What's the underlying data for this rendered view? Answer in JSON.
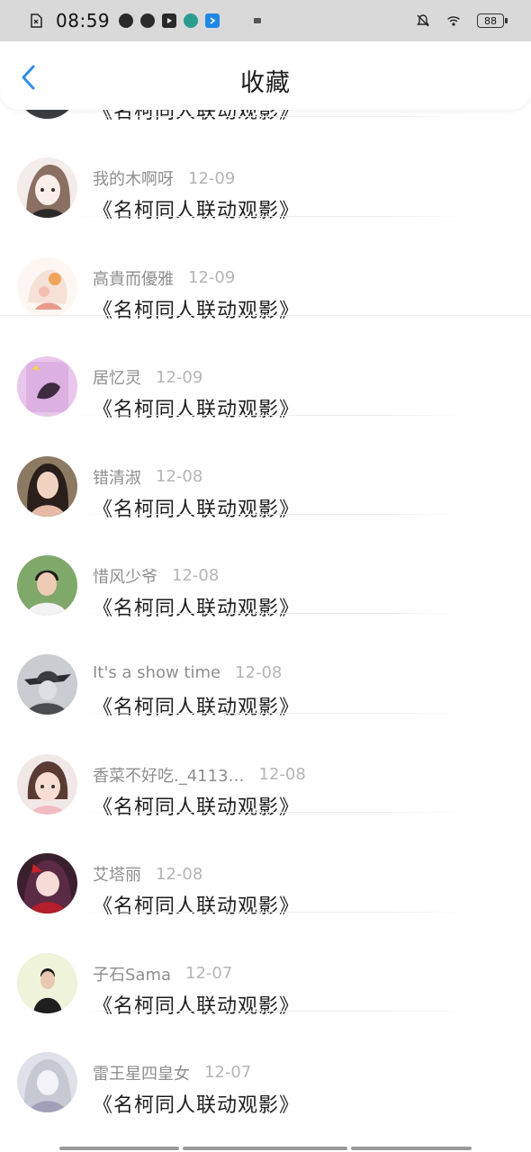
{
  "status_bar": {
    "time": "08:59",
    "battery": "88"
  },
  "header": {
    "title": "收藏"
  },
  "items": [
    {
      "user": "",
      "date": "",
      "title": "《名柯同人联动观影》"
    },
    {
      "user": "我的木啊呀",
      "date": "12-09",
      "title": "《名柯同人联动观影》"
    },
    {
      "user": "高貴而優雅",
      "date": "12-09",
      "title": "《名柯同人联动观影》"
    },
    {
      "user": "居忆灵",
      "date": "12-09",
      "title": "《名柯同人联动观影》"
    },
    {
      "user": "错清淑",
      "date": "12-08",
      "title": "《名柯同人联动观影》"
    },
    {
      "user": "惜风少爷",
      "date": "12-08",
      "title": "《名柯同人联动观影》"
    },
    {
      "user": "It's a show time",
      "date": "12-08",
      "title": "《名柯同人联动观影》"
    },
    {
      "user": "香菜不好吃._4113…",
      "date": "12-08",
      "title": "《名柯同人联动观影》"
    },
    {
      "user": "艾塔丽",
      "date": "12-08",
      "title": "《名柯同人联动观影》"
    },
    {
      "user": "子石Sama",
      "date": "12-07",
      "title": "《名柯同人联动观影》"
    },
    {
      "user": "雷王星四皇女",
      "date": "12-07",
      "title": "《名柯同人联动观影》"
    }
  ],
  "colors": {
    "accent": "#2f8cf0",
    "status_bar_bg": "#d9d9d9",
    "meta_text": "#8e8e8e",
    "date_text": "#b5b5b5"
  }
}
